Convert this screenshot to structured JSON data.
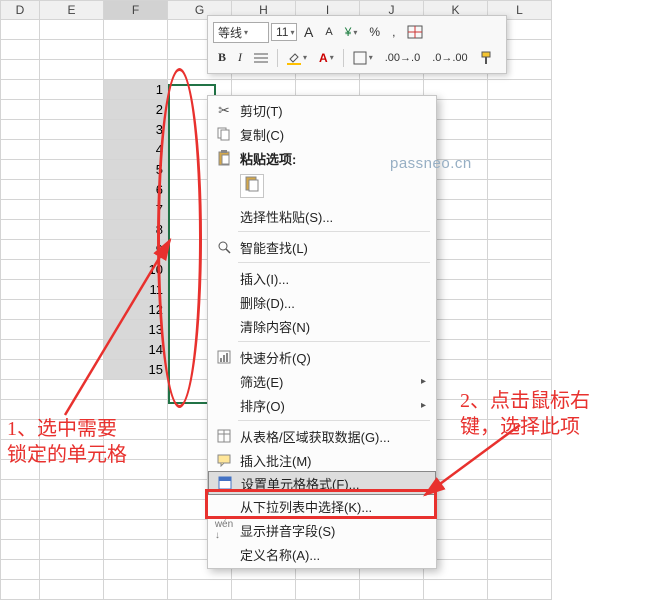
{
  "columns": [
    "D",
    "E",
    "F",
    "G",
    "H",
    "I",
    "J",
    "K",
    "L"
  ],
  "selected_column": "F",
  "cells_F": [
    "1",
    "2",
    "3",
    "4",
    "5",
    "6",
    "7",
    "8",
    "9",
    "10",
    "11",
    "12",
    "13",
    "14",
    "15"
  ],
  "mini_toolbar": {
    "font_name": "等线",
    "font_size": "11",
    "grow_font": "A",
    "shrink_font": "A",
    "percent": "%",
    "comma": ",",
    "bold": "B",
    "italic": "I"
  },
  "context_menu": {
    "cut": "剪切(T)",
    "copy": "复制(C)",
    "paste_header": "粘贴选项:",
    "paste_special": "选择性粘贴(S)...",
    "smart_lookup": "智能查找(L)",
    "insert": "插入(I)...",
    "delete": "删除(D)...",
    "clear": "清除内容(N)",
    "quick_analysis": "快速分析(Q)",
    "filter": "筛选(E)",
    "sort": "排序(O)",
    "get_table_data": "从表格/区域获取数据(G)...",
    "insert_comment": "插入批注(M)",
    "format_cells": "设置单元格格式(F)...",
    "pick_from_list": "从下拉列表中选择(K)...",
    "show_phonetic": "显示拼音字段(S)",
    "define_name": "定义名称(A)..."
  },
  "annotations": {
    "a1_l1": "1、选中需要",
    "a1_l2": "锁定的单元格",
    "a2_l1": "2、点击鼠标右",
    "a2_l2": "键，选择此项"
  },
  "watermark": "passneo.cn"
}
